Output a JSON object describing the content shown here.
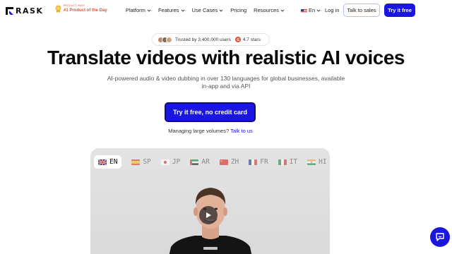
{
  "brand": {
    "name": "RASK",
    "badge_small": "PRODUCT HUNT",
    "badge_main": "#1 Product of the Day"
  },
  "nav": {
    "items": [
      "Platform",
      "Features",
      "Use Cases",
      "Pricing",
      "Resources"
    ]
  },
  "header": {
    "language": "En",
    "login": "Log in",
    "talk_to_sales": "Talk to sales",
    "try_free": "Try it free"
  },
  "trust": {
    "text": "Trusted by 3,400,000 users",
    "rating": "4.7 stars"
  },
  "hero": {
    "title": "Translate videos with realistic AI voices",
    "subtitle": "AI-powered audio & video dubbing in over 130 languages for global businesses, available in-app and via API",
    "cta": "Try it free, no credit card",
    "manage_text": "Managing large volumes?",
    "manage_link": "Talk to us"
  },
  "video": {
    "languages": [
      {
        "code": "EN",
        "active": true
      },
      {
        "code": "SP",
        "active": false
      },
      {
        "code": "JP",
        "active": false
      },
      {
        "code": "AR",
        "active": false
      },
      {
        "code": "ZH",
        "active": false
      },
      {
        "code": "FR",
        "active": false
      },
      {
        "code": "IT",
        "active": false
      },
      {
        "code": "HI",
        "active": false
      }
    ]
  },
  "colors": {
    "accent": "#1a16e0",
    "badge": "#d4543a"
  },
  "icons": [
    "rask-logo-icon",
    "product-hunt-medal-icon",
    "chevron-down-icon",
    "us-flag-icon",
    "g2-icon",
    "play-icon",
    "chat-icon"
  ]
}
